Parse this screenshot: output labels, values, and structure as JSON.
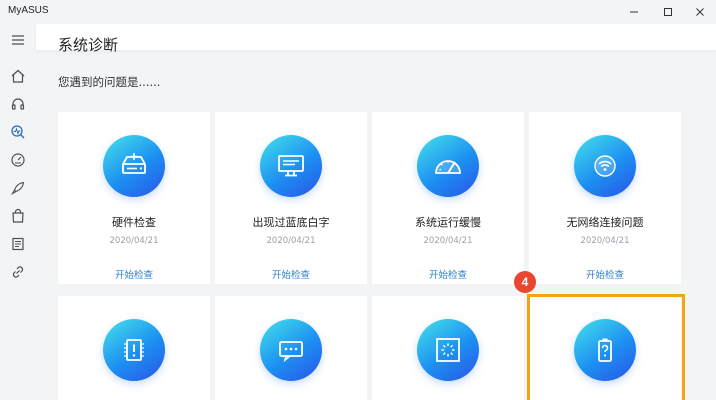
{
  "window": {
    "title": "MyASUS"
  },
  "header": {
    "title": "系统诊断"
  },
  "main": {
    "subtitle": "您遇到的问题是......"
  },
  "cards": [
    {
      "name": "硬件检查",
      "date": "2020/04/21",
      "action": "开始检查",
      "icon": "hard-drive-icon"
    },
    {
      "name": "出现过蓝底白字",
      "date": "2020/04/21",
      "action": "开始检查",
      "icon": "monitor-icon"
    },
    {
      "name": "系统运行缓慢",
      "date": "2020/04/21",
      "action": "开始检查",
      "icon": "speedometer-icon"
    },
    {
      "name": "无网络连接问题",
      "date": "2020/04/21",
      "action": "开始检查",
      "icon": "wifi-icon"
    },
    {
      "name": "",
      "icon": "chip-icon"
    },
    {
      "name": "",
      "icon": "chat-screen-icon"
    },
    {
      "name": "",
      "icon": "loading-screen-icon"
    },
    {
      "name": "",
      "icon": "battery-question-icon"
    }
  ],
  "annotation": {
    "badge": "4"
  },
  "colors": {
    "accent": "#2a7fd0",
    "highlight": "#f3a316",
    "badge": "#e8462f"
  }
}
